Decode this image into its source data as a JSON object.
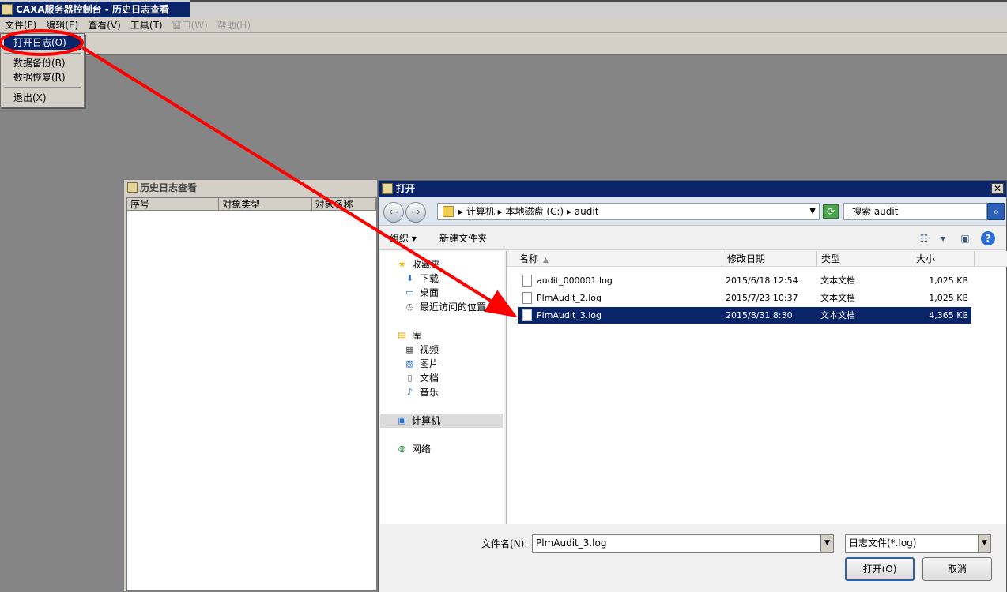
{
  "app": {
    "title": "CAXA服务器控制台 - 历史日志查看"
  },
  "menubar": {
    "items": [
      {
        "label": "文件(F)",
        "enabled": true
      },
      {
        "label": "编辑(E)",
        "enabled": true
      },
      {
        "label": "查看(V)",
        "enabled": true
      },
      {
        "label": "工具(T)",
        "enabled": true
      },
      {
        "label": "窗口(W)",
        "enabled": false
      },
      {
        "label": "帮助(H)",
        "enabled": false
      }
    ]
  },
  "file_menu": {
    "open_log": "打开日志(O)",
    "backup": "数据备份(B)",
    "restore": "数据恢复(R)",
    "exit": "退出(X)"
  },
  "history_window": {
    "title": "历史日志查看",
    "columns": [
      "序号",
      "对象类型",
      "对象名称"
    ]
  },
  "open_dialog": {
    "title": "打开",
    "close_glyph": "✕",
    "address": {
      "parts": [
        "计算机",
        "本地磁盘 (C:)",
        "audit"
      ]
    },
    "search_placeholder": "搜索 audit",
    "toolbar": {
      "organize": "组织",
      "new_folder": "新建文件夹"
    },
    "nav": {
      "favorites": "收藏夹",
      "downloads": "下载",
      "desktop": "桌面",
      "recent": "最近访问的位置",
      "libraries": "库",
      "videos": "视频",
      "pictures": "图片",
      "documents": "文档",
      "music": "音乐",
      "computer": "计算机",
      "network": "网络"
    },
    "columns": {
      "name": "名称",
      "modified": "修改日期",
      "type": "类型",
      "size": "大小"
    },
    "files": [
      {
        "name": "audit_000001.log",
        "modified": "2015/6/18 12:54",
        "type": "文本文档",
        "size": "1,025 KB"
      },
      {
        "name": "PlmAudit_2.log",
        "modified": "2015/7/23 10:37",
        "type": "文本文档",
        "size": "1,025 KB"
      },
      {
        "name": "PlmAudit_3.log",
        "modified": "2015/8/31 8:30",
        "type": "文本文档",
        "size": "4,365 KB"
      }
    ],
    "filename_label": "文件名(N):",
    "filename_value": "PlmAudit_3.log",
    "filetype_value": "日志文件(*.log)",
    "open_button": "打开(O)",
    "cancel_button": "取消"
  },
  "colors": {
    "selection": "#0a246a",
    "annotation": "#ff0000"
  }
}
